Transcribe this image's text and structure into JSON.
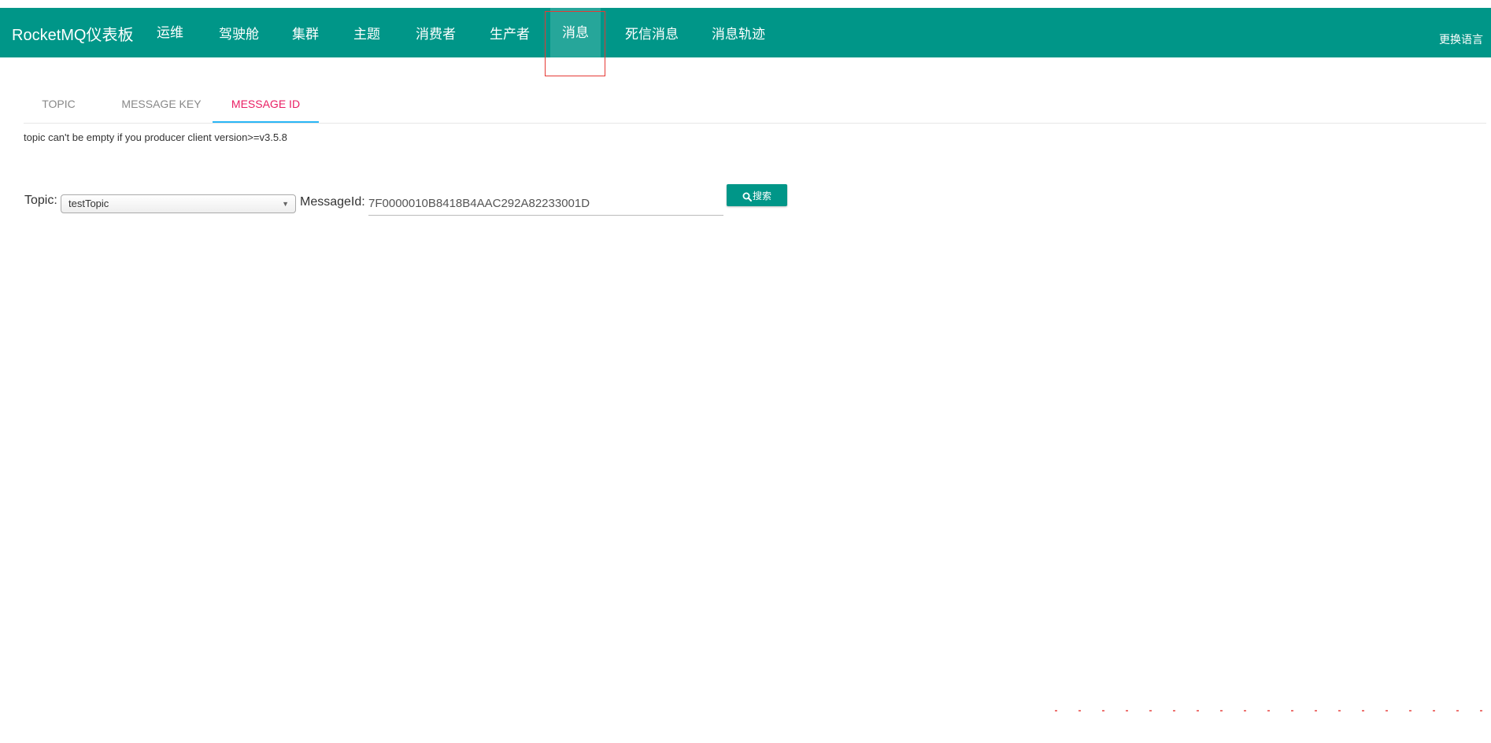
{
  "navbar": {
    "brand": "RocketMQ仪表板",
    "items": [
      {
        "label": "运维"
      },
      {
        "label": "驾驶舱"
      },
      {
        "label": "集群"
      },
      {
        "label": "主题"
      },
      {
        "label": "消费者"
      },
      {
        "label": "生产者"
      },
      {
        "label": "消息",
        "active": true
      },
      {
        "label": "死信消息"
      },
      {
        "label": "消息轨迹"
      }
    ],
    "right_label": "更换语言",
    "color": "#009688"
  },
  "tabs": [
    {
      "label": "TOPIC"
    },
    {
      "label": "MESSAGE KEY"
    },
    {
      "label": "MESSAGE ID",
      "active": true
    }
  ],
  "hint": "topic can't be empty if you producer client version>=v3.5.8",
  "form": {
    "topic_label": "Topic:",
    "topic_value": "testTopic",
    "messageid_label": "MessageId:",
    "messageid_value": "7F0000010B8418B4AAC292A82233001D",
    "search_label": "搜索"
  },
  "icons": {
    "search": "search-icon",
    "dropdown": "chevron-down-icon"
  },
  "colors": {
    "primary": "#009688",
    "active_tab_text": "#e91e63",
    "active_tab_underline": "#29b6f6",
    "highlight": "#e53935"
  }
}
